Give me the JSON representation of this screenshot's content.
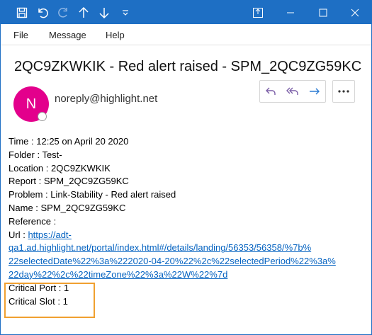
{
  "menu": {
    "file": "File",
    "message": "Message",
    "help": "Help"
  },
  "subject": "2QC9ZKWKIK - Red alert raised - SPM_2QC9ZG59KC",
  "sender": {
    "avatar_initial": "N",
    "address": "noreply@highlight.net"
  },
  "body": {
    "time": "Time : 12:25 on April 20 2020",
    "folder": "Folder : Test-",
    "location": "Location : 2QC9ZKWKIK",
    "report": "Report : SPM_2QC9ZG59KC",
    "problem": "Problem : Link-Stability - Red alert raised",
    "name": "Name : SPM_2QC9ZG59KC",
    "reference": "Reference :",
    "url_label": "Url : ",
    "url_line1": "https://adt-",
    "url_line2": "qa1.ad.highlight.net/portal/index.html#/details/landing/56353/56358/%7b%",
    "url_line3": "22selectedDate%22%3a%222020-04-20%22%2c%22selectedPeriod%22%3a%",
    "url_line4": "22day%22%2c%22timeZone%22%3a%22W%22%7d",
    "critical_port": "Critical Port : 1",
    "critical_slot": "Critical Slot : 1"
  },
  "colors": {
    "titlebar": "#1e6fc4",
    "avatar": "#e3008c",
    "link": "#0563c1",
    "accent_icon": "#7b5ea7",
    "forward_icon": "#2b7cd3",
    "highlight": "#f0a030"
  }
}
